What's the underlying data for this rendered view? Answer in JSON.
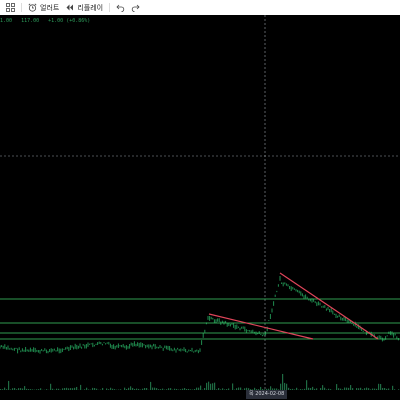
{
  "toolbar": {
    "alert_label": "얼러트",
    "replay_label": "리플레이",
    "icons": [
      "grid-icon",
      "alarm-clock-icon",
      "replay-icon",
      "undo-icon",
      "redo-icon"
    ]
  },
  "legend": {
    "first": "1.00",
    "price": "117.00",
    "change": "+1.00 (+0.86%)"
  },
  "crosshair": {
    "date_label": "목 2024-02-08"
  },
  "colors": {
    "background": "#000000",
    "candles": "#1f8c4f",
    "support_resistance": "#3fcf6c",
    "trend_lines": "#e0455a",
    "volume": "#1f6b43",
    "crosshair": "#9aa0a6"
  },
  "chart_data": {
    "type": "candlestick",
    "horizontal_levels": 4,
    "trend_lines": 2,
    "volume_bars": true
  }
}
